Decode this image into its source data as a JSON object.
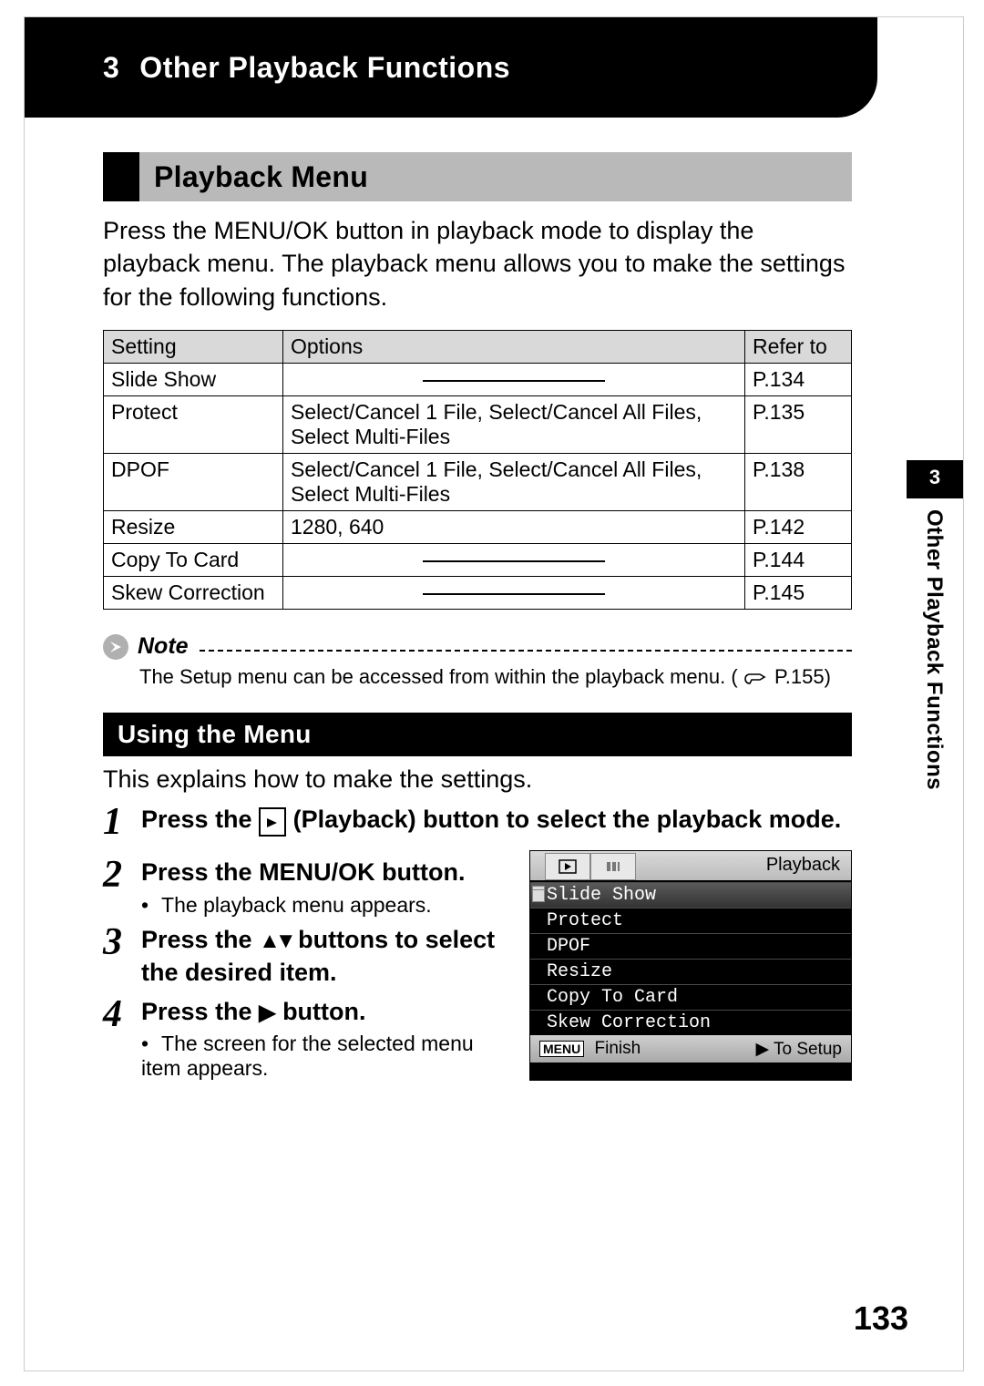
{
  "header": {
    "chapter_num": "3",
    "chapter_title": "Other Playback Functions"
  },
  "section_title": "Playback Menu",
  "intro": "Press the MENU/OK button in playback mode to display the playback menu. The playback menu allows you to make the settings for the following functions.",
  "table": {
    "headers": {
      "setting": "Setting",
      "options": "Options",
      "refer": "Refer to"
    },
    "rows": [
      {
        "setting": "Slide Show",
        "options": "—",
        "refer": "P.134",
        "dash": true
      },
      {
        "setting": "Protect",
        "options": "Select/Cancel 1 File, Select/Cancel All Files, Select Multi-Files",
        "refer": "P.135",
        "dash": false
      },
      {
        "setting": "DPOF",
        "options": "Select/Cancel 1 File, Select/Cancel All Files, Select Multi-Files",
        "refer": "P.138",
        "dash": false
      },
      {
        "setting": "Resize",
        "options": "1280, 640",
        "refer": "P.142",
        "dash": false
      },
      {
        "setting": "Copy To Card",
        "options": "—",
        "refer": "P.144",
        "dash": true
      },
      {
        "setting": "Skew Correction",
        "options": "—",
        "refer": "P.145",
        "dash": true
      }
    ]
  },
  "note": {
    "label": "Note",
    "body_pre": "The Setup menu can be accessed from within the playback menu. (",
    "body_ref": "P.155)",
    "ref_page": "P.155"
  },
  "using": {
    "heading": "Using the Menu",
    "intro": "This explains how to make the settings.",
    "steps": [
      {
        "n": "1",
        "title_pre": "Press the ",
        "title_mid": " (Playback) button to select the playback mode.",
        "sub": ""
      },
      {
        "n": "2",
        "title": "Press the MENU/OK button.",
        "sub": "The playback menu appears."
      },
      {
        "n": "3",
        "title_pre": "Press the ",
        "title_post": " buttons to select the desired item.",
        "sub": ""
      },
      {
        "n": "4",
        "title_pre": "Press the ",
        "title_post": " button.",
        "sub": "The screen for the selected menu item appears."
      }
    ]
  },
  "lcd": {
    "title": "Playback",
    "items": [
      "Slide Show",
      "Protect",
      "DPOF",
      "Resize",
      "Copy To Card",
      "Skew Correction"
    ],
    "bottom_left": "Finish",
    "bottom_right": "To Setup",
    "menu_badge": "MENU"
  },
  "side": {
    "num": "3",
    "text": "Other Playback Functions"
  },
  "page_number": "133"
}
